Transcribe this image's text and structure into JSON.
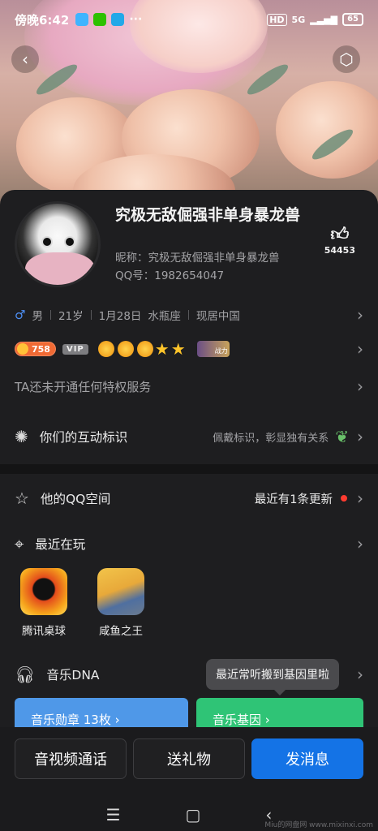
{
  "status": {
    "time": "傍晚6:42",
    "right_badges": [
      "HD",
      "5G"
    ],
    "battery": "65"
  },
  "header": {
    "back_label": "‹",
    "more_label": "⬡"
  },
  "profile": {
    "nickname": "究极无敌倔强非单身暴龙兽",
    "nickname_line": "昵称：究极无敌倔强非单身暴龙兽",
    "qq_line": "QQ号：1982654047",
    "likes": "54453"
  },
  "info_row": {
    "gender_icon": "♂",
    "items": [
      "男",
      "21岁",
      "1月28日",
      "水瓶座",
      "现居中国"
    ]
  },
  "level_row": {
    "level": "758",
    "vip": "VIP",
    "mini_badge": "战力"
  },
  "privilege_row": {
    "text": "TA还未开通任何特权服务"
  },
  "interaction_row": {
    "title": "你们的互动标识",
    "hint": "佩戴标识，彰显独有关系"
  },
  "qzone_row": {
    "title": "他的QQ空间",
    "update": "最近有1条更新"
  },
  "recent_play": {
    "title": "最近在玩",
    "games": [
      {
        "name": "腾讯桌球"
      },
      {
        "name": "咸鱼之王"
      }
    ]
  },
  "music": {
    "title": "音乐DNA",
    "tooltip": "最近常听搬到基因里啦",
    "card_left": "音乐勋章 13枚 ›",
    "card_right": "音乐基因 ›"
  },
  "actions": {
    "call": "音视频通话",
    "gift": "送礼物",
    "message": "发消息"
  },
  "nav": {
    "menu": "☰",
    "home": "▢",
    "back": "‹"
  },
  "watermark": "Miu的网盘网 www.mixinxi.com",
  "colors": {
    "primary": "#1473e6",
    "level": "#f06a34",
    "music_left": "#4f98e8",
    "music_right": "#2fc476"
  }
}
